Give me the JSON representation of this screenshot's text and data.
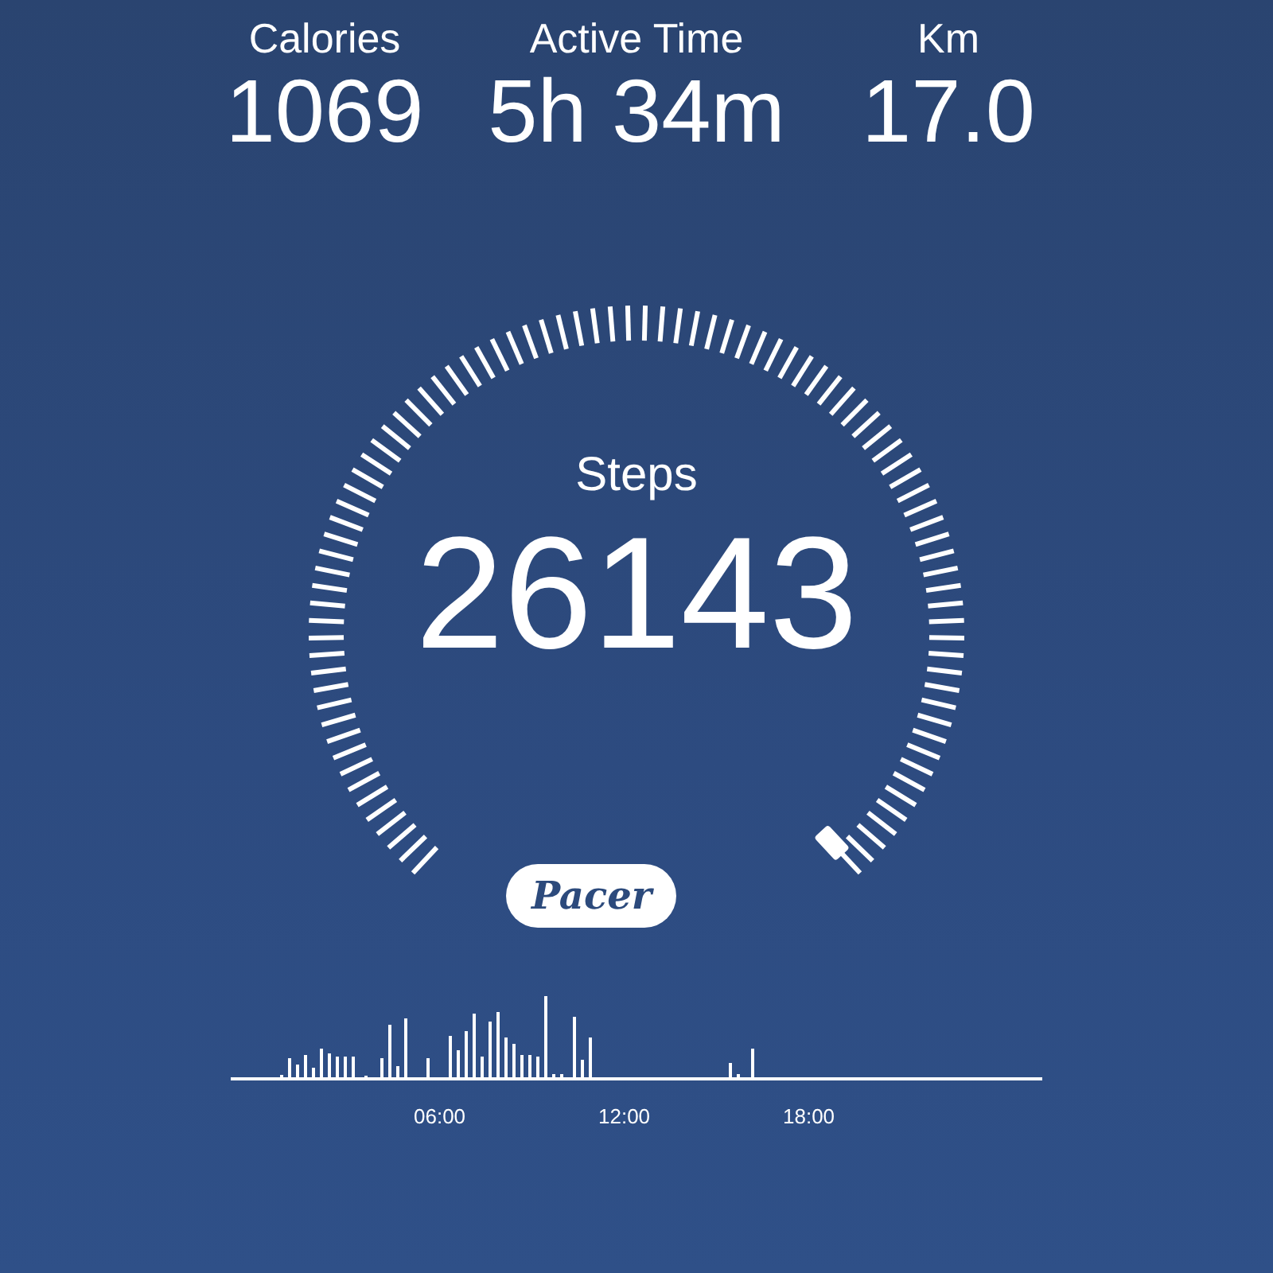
{
  "stats": [
    {
      "label": "Calories",
      "value": "1069"
    },
    {
      "label": "Active Time",
      "value": "5h 34m"
    },
    {
      "label": "Km",
      "value": "17.0"
    }
  ],
  "gauge": {
    "label": "Steps",
    "value": "26143"
  },
  "logo": {
    "text": "Pacer"
  },
  "activity_chart": {
    "x_labels": [
      "06:00",
      "12:00",
      "18:00"
    ]
  }
}
